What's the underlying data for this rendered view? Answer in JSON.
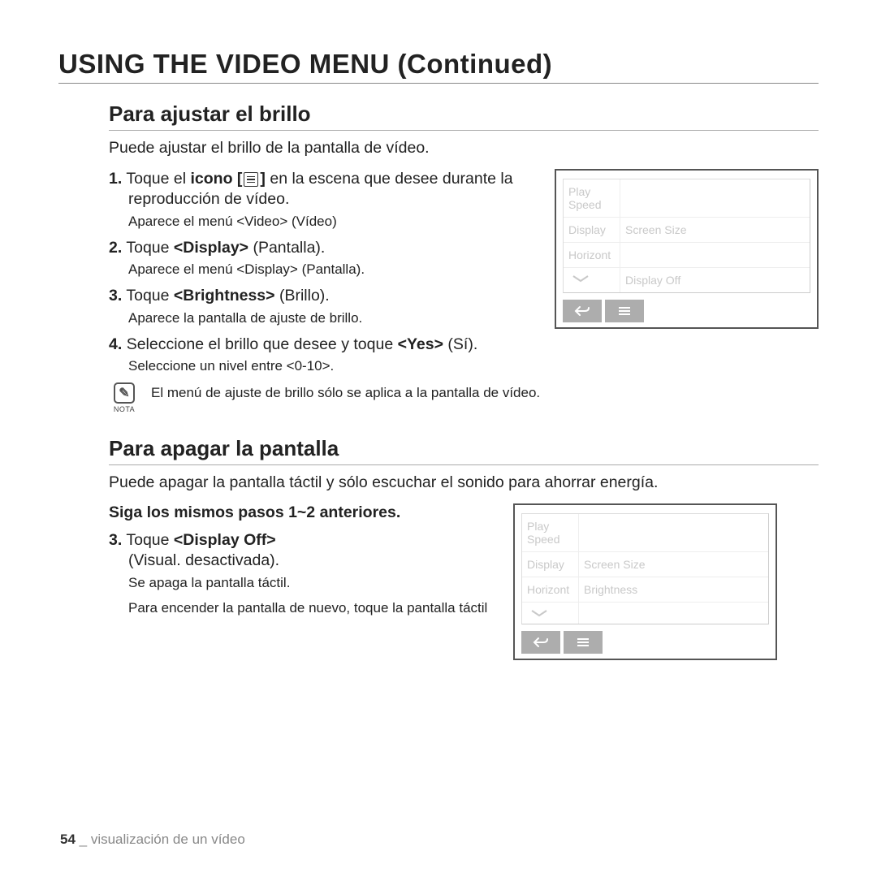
{
  "page_title": "USING THE VIDEO MENU (Continued)",
  "section1": {
    "heading": "Para ajustar el brillo",
    "intro": "Puede ajustar el brillo de la pantalla de vídeo.",
    "step1_pre": "Toque el ",
    "step1_bold": "icono [",
    "step1_post": "] ",
    "step1_tail": "en la escena que desee durante la reproducción de vídeo.",
    "sub1": "Aparece el menú <Video> (Vídeo)",
    "step2_pre": "Toque ",
    "step2_bold": "<Display>",
    "step2_post": " (Pantalla).",
    "sub2": "Aparece el menú <Display> (Pantalla).",
    "step3_pre": "Toque ",
    "step3_bold": "<Brightness>",
    "step3_post": " (Brillo).",
    "sub3": "Aparece la pantalla de ajuste de brillo.",
    "step4_pre": "Seleccione el brillo que desee y toque ",
    "step4_bold": "<Yes>",
    "step4_post": " (Sí).",
    "sub4": "Seleccione un nivel entre <0-10>.",
    "note_label": "NOTA",
    "note_text": "El menú de ajuste de brillo sólo se aplica a la pantalla de vídeo."
  },
  "section2": {
    "heading": "Para apagar la pantalla",
    "intro": "Puede apagar la pantalla táctil y sólo escuchar el sonido para ahorrar energía.",
    "bold_line": "Siga los mismos pasos 1~2 anteriores.",
    "step3_pre": "Toque ",
    "step3_bold": "<Display Off>",
    "step3_tail": "(Visual. desactivada).",
    "sub3a": "Se apaga la pantalla táctil.",
    "sub3b": "Para encender la pantalla de nuevo, toque la pantalla táctil"
  },
  "device1": {
    "row1": "Play Speed",
    "row2a": "Display",
    "row2b": "Screen Size",
    "row3a": "Horizont",
    "row4b": "Display Off"
  },
  "device2": {
    "row1": "Play Speed",
    "row2a": "Display",
    "row2b": "Screen Size",
    "row3a": "Horizont",
    "row3b": "Brightness"
  },
  "footer": {
    "page_num": "54",
    "sep": " _ ",
    "text": "visualización de un vídeo"
  }
}
